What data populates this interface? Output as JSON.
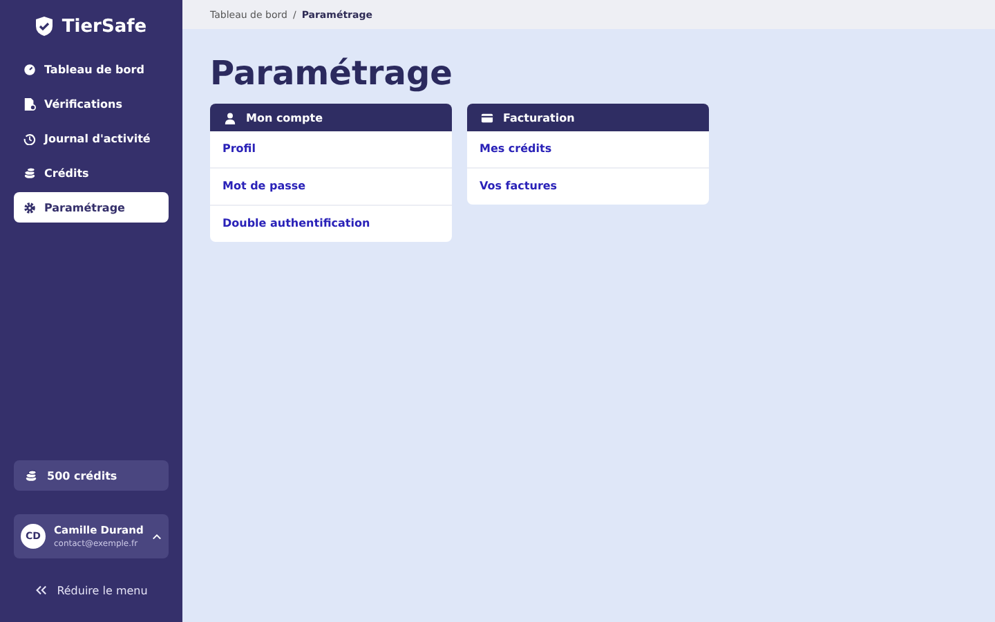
{
  "sidebar": {
    "logo": "TierSafe",
    "items": [
      {
        "label": "Tableau de bord",
        "selected": false
      },
      {
        "label": "Vérifications",
        "selected": false
      },
      {
        "label": "Journal d'activité",
        "selected": false
      },
      {
        "label": "Crédits",
        "selected": false
      },
      {
        "label": "Paramétrage",
        "selected": true
      }
    ],
    "credits": "500 crédits",
    "user": {
      "initials": "CD",
      "name": "Camille Durand",
      "email": "contact@exemple.fr"
    },
    "collapse": "Réduire le menu"
  },
  "breadcrumb": {
    "separator": "/",
    "items": [
      {
        "label": "Tableau de bord",
        "current": false
      },
      {
        "label": "Paramétrage",
        "current": true
      }
    ]
  },
  "title": "Paramétrage",
  "cards": [
    {
      "title": "Mon compte",
      "links": [
        "Profil",
        "Mot de passe",
        "Double authentification"
      ]
    },
    {
      "title": "Facturation",
      "links": [
        "Mes crédits",
        "Vos factures"
      ]
    }
  ]
}
